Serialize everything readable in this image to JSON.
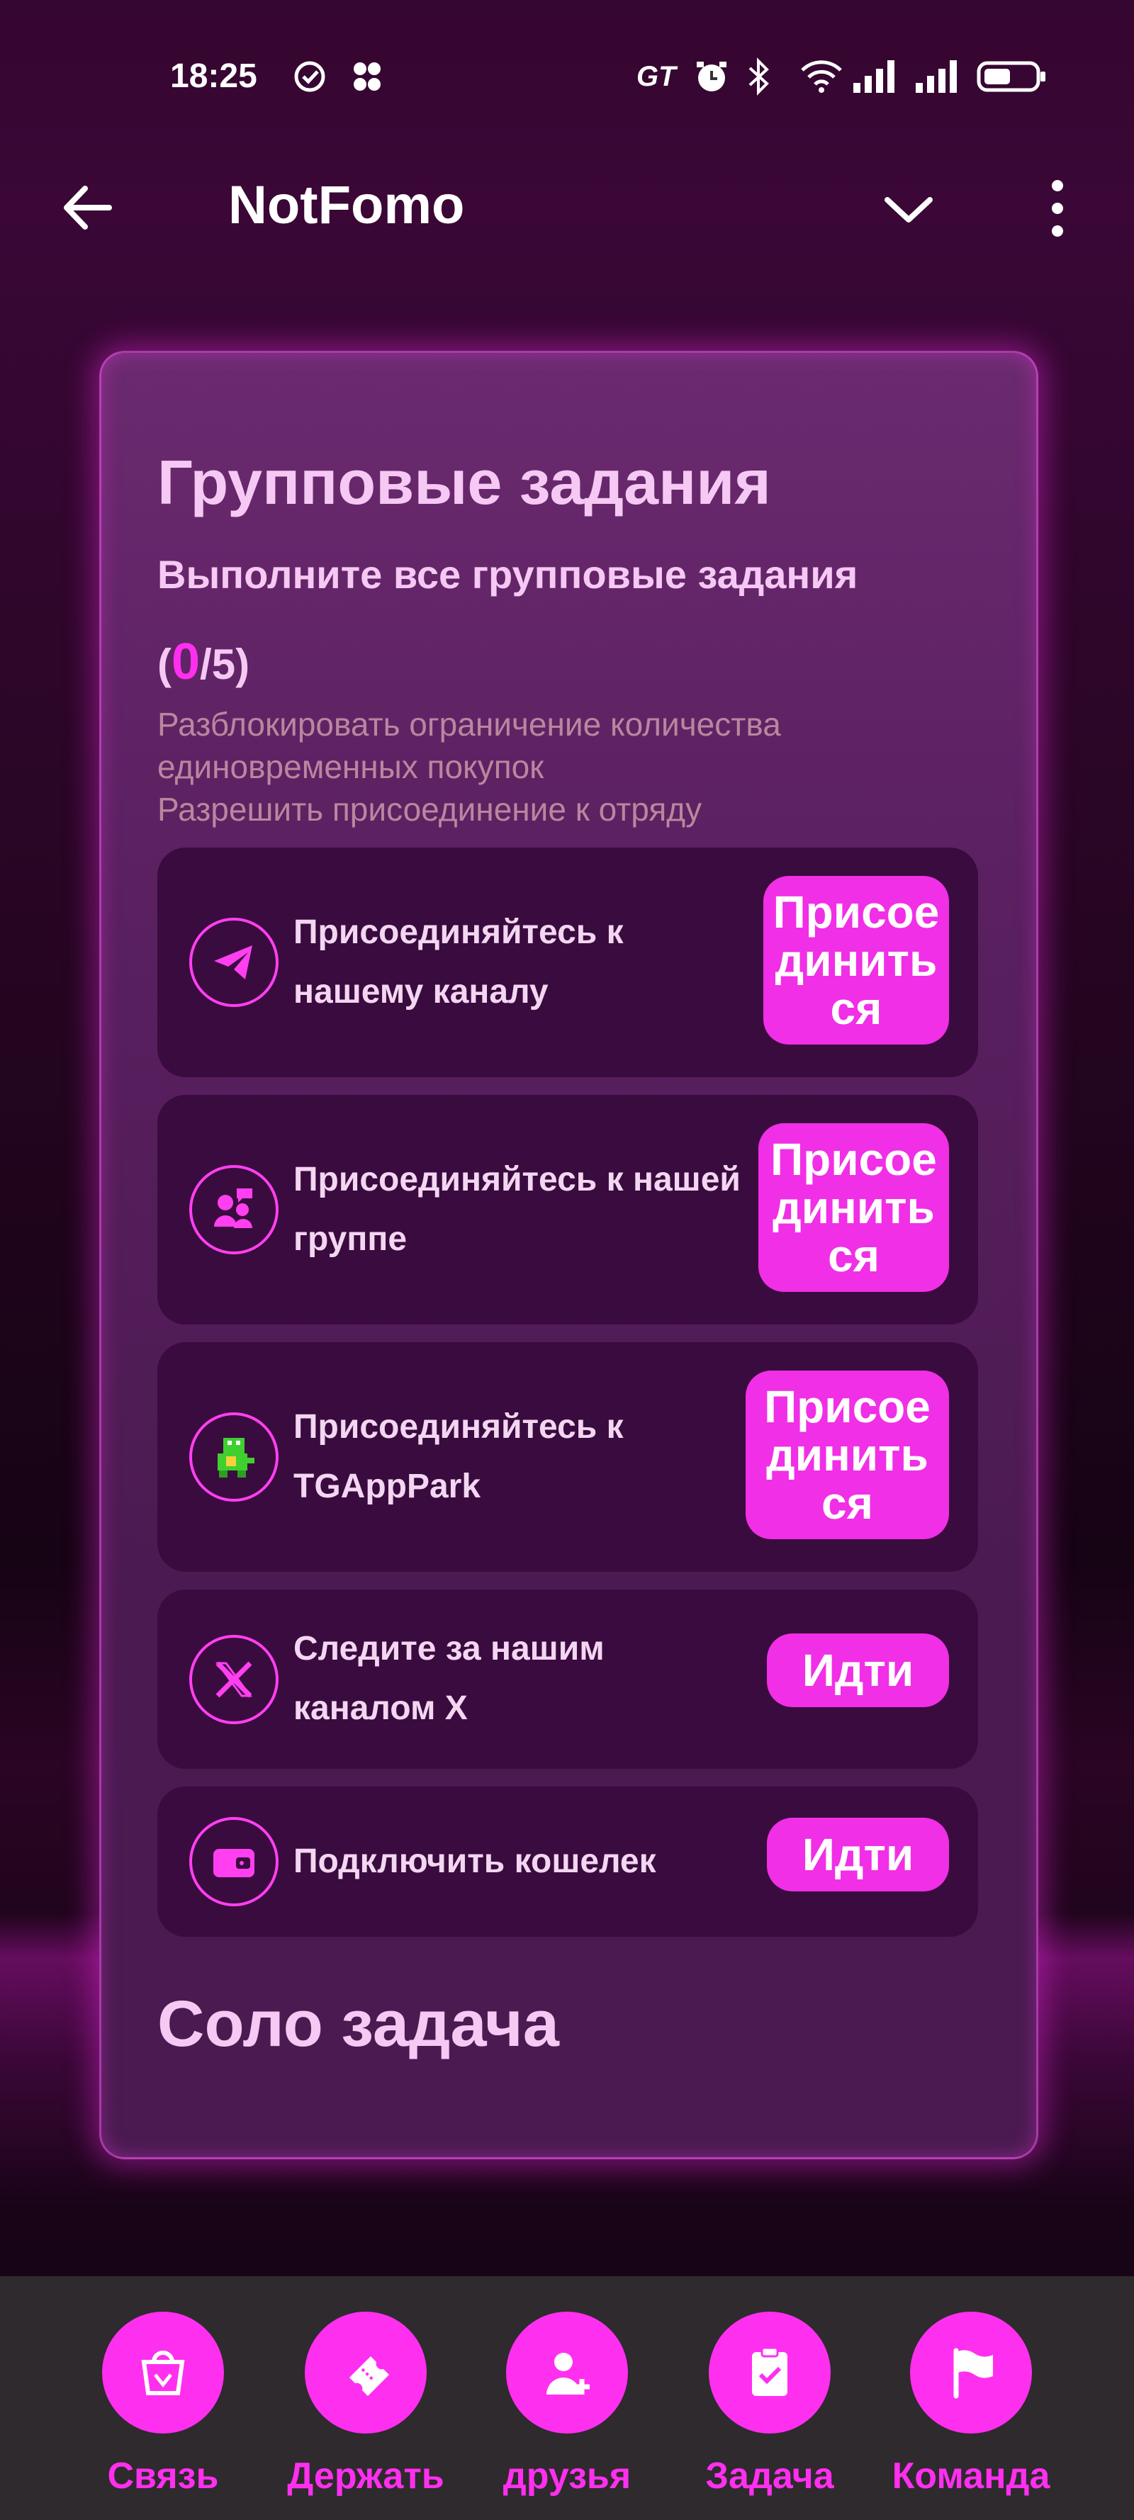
{
  "status_bar": {
    "time": "18:25",
    "icons": [
      "check-circle-icon",
      "dots-icon",
      "gt-icon",
      "alarm-icon",
      "bluetooth-icon",
      "wifi-icon",
      "signal-icon",
      "signal-icon",
      "battery-icon"
    ]
  },
  "app_bar": {
    "title": "NotFomo",
    "back_icon": "arrow-left-icon",
    "collapse_icon": "chevron-down-icon",
    "menu_icon": "more-vertical-icon"
  },
  "group_tasks": {
    "title": "Групповые задания",
    "subtitle": "Выполните все групповые задания",
    "progress_open": "(",
    "progress_done": "0",
    "progress_total": "/5)",
    "desc_line1": "Разблокировать ограничение количества",
    "desc_line2": "единовременных покупок",
    "desc_line3": "Разрешить присоединение к отряду",
    "items": [
      {
        "icon": "telegram-icon",
        "label": "Присоединяйтесь к нашему каналу",
        "button": "Присоединиться"
      },
      {
        "icon": "group-icon",
        "label": "Присоединяйтесь к нашей группе",
        "button": "Присоединиться"
      },
      {
        "icon": "dino-icon",
        "label": "Присоединяйтесь к TGAppPark",
        "button": "Присоединиться"
      },
      {
        "icon": "x-icon",
        "label": "Следите за нашим каналом X",
        "button": "Идти"
      },
      {
        "icon": "wallet-icon",
        "label": "Подключить кошелек",
        "button": "Идти"
      }
    ]
  },
  "solo": {
    "title": "Соло задача"
  },
  "bottom_nav": [
    {
      "icon": "shop-icon",
      "label": "Связь"
    },
    {
      "icon": "ticket-icon",
      "label": "Держать"
    },
    {
      "icon": "add-friend-icon",
      "label": "друзья"
    },
    {
      "icon": "task-icon",
      "label": "Задача"
    },
    {
      "icon": "flag-icon",
      "label": "Команда"
    }
  ],
  "colors": {
    "accent": "#ff2ff0",
    "card_bg": "#5a2060",
    "task_bg": "#3a0b3e",
    "nav_bg": "#2e2a2d"
  }
}
